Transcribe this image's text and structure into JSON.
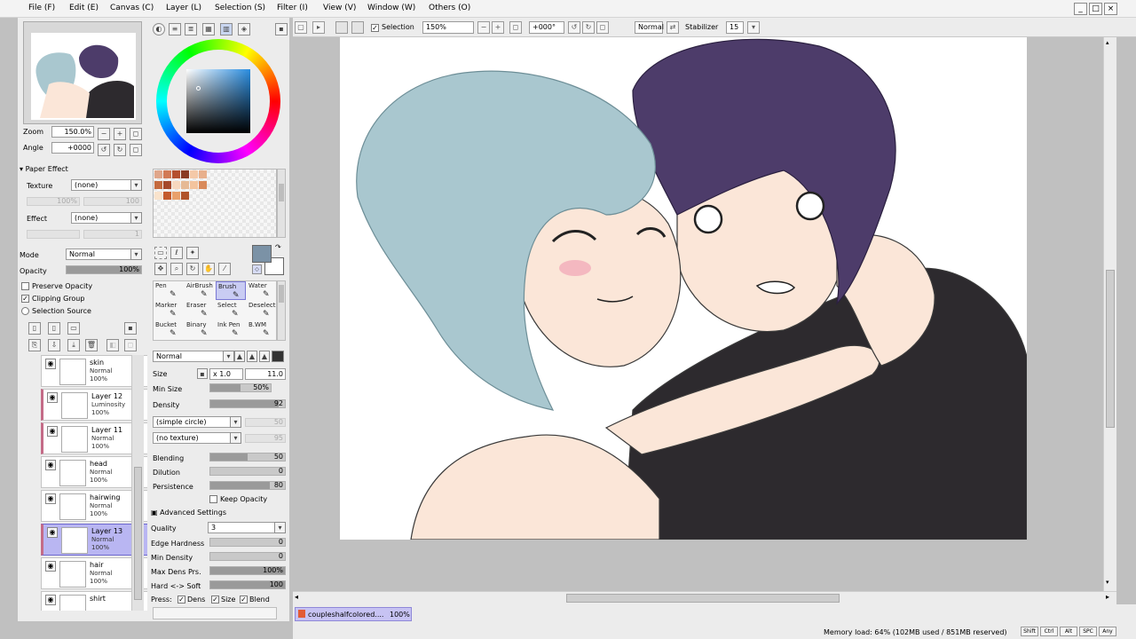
{
  "menu": {
    "items": [
      "File (F)",
      "Edit (E)",
      "Canvas (C)",
      "Layer (L)",
      "Selection (S)",
      "Filter (I)",
      "View (V)",
      "Window (W)",
      "Others (O)"
    ],
    "window_buttons": [
      "_",
      "□",
      "×"
    ]
  },
  "toolbar": {
    "selection_label": "Selection",
    "zoom_value": "150%",
    "angle_value": "+000°",
    "mode_value": "Normal",
    "stabilizer_label": "Stabilizer",
    "stabilizer_value": "15"
  },
  "navigator": {
    "zoom_label": "Zoom",
    "zoom_value": "150.0%",
    "angle_label": "Angle",
    "angle_value": "+0000"
  },
  "paper_effect": {
    "header": "Paper Effect",
    "texture_label": "Texture",
    "texture_value": "(none)",
    "effect_label": "Effect",
    "effect_value": "(none)",
    "texture_scale": "100%",
    "texture_strength": "100",
    "effect_width": "1"
  },
  "layer_props": {
    "mode_label": "Mode",
    "mode_value": "Normal",
    "opacity_label": "Opacity",
    "opacity_value": "100%",
    "opacity_fraction": 1.0,
    "preserve_opacity": "Preserve Opacity",
    "clipping_group": "Clipping Group",
    "selection_source": "Selection Source"
  },
  "layers": [
    {
      "name": "skin",
      "mode": "Normal",
      "opacity": "100%",
      "selected": false,
      "clipped": false
    },
    {
      "name": "Layer 12",
      "mode": "Luminosity",
      "opacity": "100%",
      "selected": false,
      "clipped": true
    },
    {
      "name": "Layer 11",
      "mode": "Normal",
      "opacity": "100%",
      "selected": false,
      "clipped": true
    },
    {
      "name": "head",
      "mode": "Normal",
      "opacity": "100%",
      "selected": false,
      "clipped": false
    },
    {
      "name": "hairwing",
      "mode": "Normal",
      "opacity": "100%",
      "selected": false,
      "clipped": false
    },
    {
      "name": "Layer 13",
      "mode": "Normal",
      "opacity": "100%",
      "selected": true,
      "clipped": true
    },
    {
      "name": "hair",
      "mode": "Normal",
      "opacity": "100%",
      "selected": false,
      "clipped": false
    },
    {
      "name": "shirt",
      "mode": "",
      "opacity": "",
      "selected": false,
      "clipped": false
    }
  ],
  "tools": {
    "row1": [
      "Pen",
      "AirBrush",
      "Brush",
      "Water"
    ],
    "row2": [
      "Marker",
      "Eraser",
      "Select",
      "Deselect"
    ],
    "row3": [
      "Bucket",
      "Binary",
      "Ink Pen",
      "B.WM"
    ],
    "selected": "Brush"
  },
  "brush": {
    "blend_mode": "Normal",
    "size_label": "Size",
    "size_mult": "x 1.0",
    "size_value": "11.0",
    "min_size_label": "Min Size",
    "min_size_value": "50%",
    "min_size_fraction": 0.5,
    "density_label": "Density",
    "density_value": "92",
    "density_fraction": 0.92,
    "shape_value": "(simple circle)",
    "texture_value": "(no texture)",
    "shape_strength": "50",
    "texture_strength": "95",
    "blending_label": "Blending",
    "blending_value": "50",
    "blending_fraction": 0.5,
    "dilution_label": "Dilution",
    "dilution_value": "0",
    "dilution_fraction": 0.0,
    "persistence_label": "Persistence",
    "persistence_value": "80",
    "persistence_fraction": 0.8,
    "keep_opacity": "Keep Opacity",
    "advanced_header": "Advanced Settings",
    "quality_label": "Quality",
    "quality_value": "3",
    "edge_label": "Edge Hardness",
    "edge_value": "0",
    "edge_fraction": 0.0,
    "min_dens_label": "Min Density",
    "min_dens_value": "0",
    "min_dens_fraction": 0.0,
    "max_dens_label": "Max Dens Prs.",
    "max_dens_value": "100%",
    "max_dens_fraction": 1.0,
    "hard_soft_label": "Hard <-> Soft",
    "hard_soft_value": "100",
    "hard_soft_fraction": 1.0,
    "press_label": "Press:",
    "press_dens": "Dens",
    "press_size": "Size",
    "press_blend": "Blend"
  },
  "colors": {
    "current_color": "#7b92a6",
    "secondary_color": "#ffffff",
    "hair_blue": "#a9c7cf",
    "hair_purple": "#4d3c6a",
    "shirt_black": "#2d2a2e",
    "skin": "#fbe6d8",
    "swatches": [
      "#e0a68a",
      "#d27a55",
      "#b5502f",
      "#8a3a22",
      "#f4c9a8",
      "#e8b08c",
      "#c46a3e",
      "#a5482a",
      "#f7d8bf",
      "#e6b995",
      "#f3c49e",
      "#d98b5c",
      "#f9e3cc",
      "#c45a2c",
      "#e9a06b",
      "#b0532a"
    ]
  },
  "document_tab": {
    "name": "coupleshalfcolored....",
    "zoom": "100%"
  },
  "status": {
    "memory": "Memory load: 64% (102MB used / 851MB reserved)",
    "keys": [
      "Shift",
      "Ctrl",
      "Alt",
      "SPC",
      "Any"
    ]
  },
  "icons": {
    "new_layer": "new-layer-icon",
    "trash": "trash-icon",
    "eye": "eye-icon"
  }
}
